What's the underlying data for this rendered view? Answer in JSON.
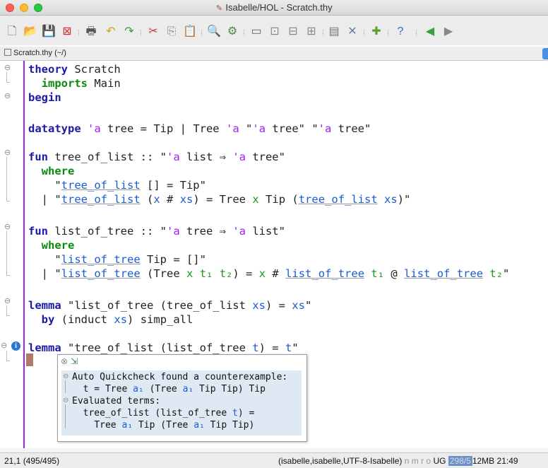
{
  "window": {
    "title": "Isabelle/HOL - Scratch.thy"
  },
  "toolbar": {
    "buttons": [
      {
        "name": "new-file-icon",
        "glyph": "🗋"
      },
      {
        "name": "open-file-icon",
        "glyph": "📂"
      },
      {
        "name": "save-file-icon",
        "glyph": "💾"
      },
      {
        "name": "close-file-icon",
        "glyph": "⊠"
      },
      {
        "name": "print-icon",
        "glyph": "🖶"
      },
      {
        "name": "undo-icon",
        "glyph": "↶"
      },
      {
        "name": "redo-icon",
        "glyph": "↷"
      },
      {
        "name": "cut-icon",
        "glyph": "✂"
      },
      {
        "name": "copy-icon",
        "glyph": "⎘"
      },
      {
        "name": "paste-icon",
        "glyph": "📋"
      },
      {
        "name": "find-icon",
        "glyph": "🔍"
      },
      {
        "name": "find-replace-icon",
        "glyph": "⚙"
      },
      {
        "name": "new-view-icon",
        "glyph": "▭"
      },
      {
        "name": "split-horizontal-icon",
        "glyph": "⊡"
      },
      {
        "name": "split-vertical-icon",
        "glyph": "⊟"
      },
      {
        "name": "unsplit-icon",
        "glyph": "⊞"
      },
      {
        "name": "buffer-options-icon",
        "glyph": "▤"
      },
      {
        "name": "global-options-icon",
        "glyph": "✕"
      },
      {
        "name": "plugin-manager-icon",
        "glyph": "✚"
      },
      {
        "name": "help-icon",
        "glyph": "?"
      },
      {
        "name": "back-icon",
        "glyph": "◀"
      },
      {
        "name": "forward-icon",
        "glyph": "▶"
      }
    ]
  },
  "tab": {
    "label": "Scratch.thy (~/)"
  },
  "editor": {
    "lines": {
      "l1": [
        "theory",
        " Scratch"
      ],
      "l2": [
        "imports",
        " Main"
      ],
      "l3": [
        "begin"
      ],
      "l5": [
        "datatype",
        " ",
        "'a",
        " tree = Tip | Tree ",
        "'a",
        " \"",
        "'a",
        " tree\" \"",
        "'a",
        " tree\""
      ],
      "l7": [
        "fun",
        " tree_of_list :: \"",
        "'a",
        " list ⇒ ",
        "'a",
        " tree\""
      ],
      "l8": [
        "where"
      ],
      "l9": [
        "\"",
        "tree_of_list",
        " [] = Tip\""
      ],
      "l10": [
        "| ",
        "\"",
        "tree_of_list",
        " (",
        "x",
        " # ",
        "xs",
        ") = Tree ",
        "x",
        " Tip (",
        "tree_of_list",
        " ",
        "xs",
        ")\""
      ],
      "l12": [
        "fun",
        " list_of_tree :: \"",
        "'a",
        " tree ⇒ ",
        "'a",
        " list\""
      ],
      "l13": [
        "where"
      ],
      "l14": [
        "\"",
        "list_of_tree",
        " Tip = []\""
      ],
      "l15": [
        "| ",
        "\"",
        "list_of_tree",
        " (Tree ",
        "x",
        " ",
        "t₁",
        " ",
        "t₂",
        ") = ",
        "x",
        " # ",
        "list_of_tree",
        " ",
        "t₁",
        " @ ",
        "list_of_tree",
        " ",
        "t₂",
        "\""
      ],
      "l17": [
        "lemma",
        " \"list_of_tree (tree_of_list ",
        "xs",
        ") = ",
        "xs",
        "\""
      ],
      "l18": [
        "by",
        " (",
        "induct",
        " ",
        "xs",
        ") simp_all"
      ],
      "l20": [
        "lemma",
        " \"tree_of_list (list_of_tree ",
        "t",
        ") = ",
        "t",
        "\""
      ]
    }
  },
  "popup": {
    "close_glyph": "⊗",
    "detach_glyph": "⇲",
    "l1": "Auto Quickcheck found a counterexample:",
    "l2a": "t = Tree ",
    "l2b": "a₁",
    "l2c": " (Tree ",
    "l2d": "a₁",
    "l2e": " Tip Tip) Tip",
    "l3": "Evaluated terms:",
    "l4a": "tree_of_list (list_of_tree ",
    "l4b": "t",
    "l4c": ") =",
    "l5a": "Tree ",
    "l5b": "a₁",
    "l5c": " Tip (Tree ",
    "l5d": "a₁",
    "l5e": " Tip Tip)"
  },
  "status": {
    "position": "21,1 (495/495)",
    "mode": "(isabelle,isabelle,UTF-8-Isabelle)",
    "flags": "n m r o",
    "ug": "UG",
    "memory_used": "298/5",
    "memory_rest": "12MB",
    "time": "21:49"
  },
  "colors": {
    "keyword": "#1a1aa6",
    "type_var": "#a020f0",
    "free_var": "#1a5bd6",
    "bound_var": "#1a9a1a",
    "gutter": "#a020f0",
    "popup_bg": "#dfe9f3"
  }
}
